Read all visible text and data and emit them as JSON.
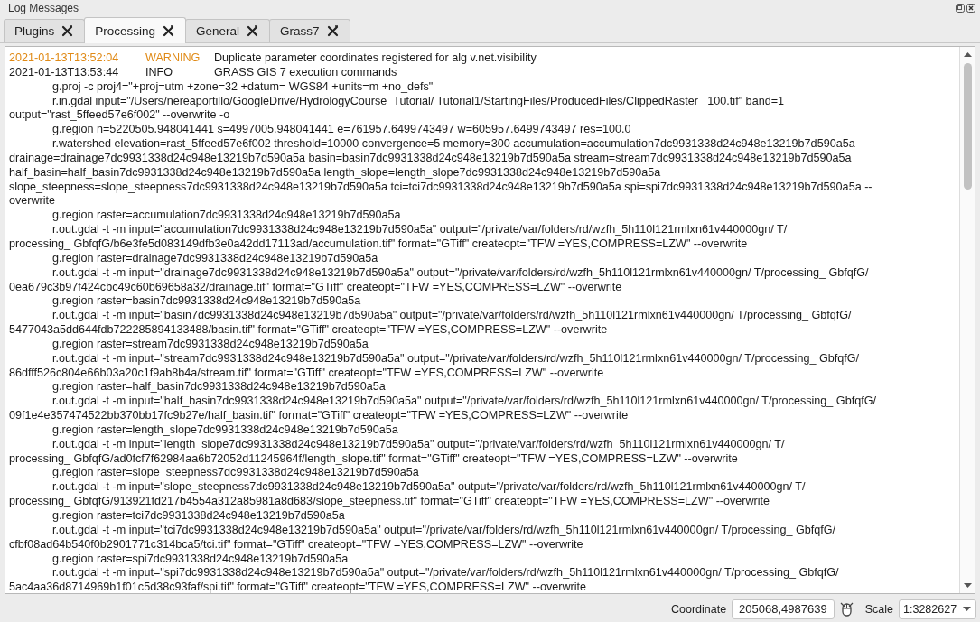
{
  "window": {
    "title": "Log Messages"
  },
  "tabs": [
    {
      "label": "Plugins",
      "selected": false
    },
    {
      "label": "Processing",
      "selected": true
    },
    {
      "label": "General",
      "selected": false
    },
    {
      "label": "Grass7",
      "selected": false
    }
  ],
  "log": {
    "entries": [
      {
        "kind": "warning",
        "time": "2021-01-13T13:52:04",
        "level": "WARNING",
        "message": "Duplicate parameter coordinates registered for alg v.net.visibility"
      },
      {
        "kind": "info",
        "time": "2021-01-13T13:53:44",
        "level": "INFO",
        "message": "GRASS GIS 7 execution commands"
      }
    ],
    "commands": [
      {
        "lines": [
          "g.proj -c proj4=\"+proj=utm +zone=32 +datum= WGS84 +units=m +no_defs\""
        ]
      },
      {
        "lines": [
          "r.in.gdal input=\"/Users/nereaportillo/GoogleDrive/HydrologyCourse_Tutorial/ Tutorial1/StartingFiles/ProducedFiles/ClippedRaster _100.tif\" band=1",
          "output=\"rast_5ffeed57e6f002\" --overwrite -o"
        ]
      },
      {
        "lines": [
          "g.region n=5220505.948041441 s=4997005.948041441 e=761957.6499743497 w=605957.6499743497 res=100.0"
        ]
      },
      {
        "lines": [
          "r.watershed elevation=rast_5ffeed57e6f002 threshold=10000 convergence=5 memory=300 accumulation=accumulation7dc9931338d24c948e13219b7d590a5a",
          "drainage=drainage7dc9931338d24c948e13219b7d590a5a basin=basin7dc9931338d24c948e13219b7d590a5a stream=stream7dc9931338d24c948e13219b7d590a5a",
          "half_basin=half_basin7dc9931338d24c948e13219b7d590a5a length_slope=length_slope7dc9931338d24c948e13219b7d590a5a",
          "slope_steepness=slope_steepness7dc9931338d24c948e13219b7d590a5a tci=tci7dc9931338d24c948e13219b7d590a5a spi=spi7dc9931338d24c948e13219b7d590a5a --",
          "overwrite"
        ]
      },
      {
        "lines": [
          "g.region raster=accumulation7dc9931338d24c948e13219b7d590a5a"
        ]
      },
      {
        "lines": [
          "r.out.gdal -t -m input=\"accumulation7dc9931338d24c948e13219b7d590a5a\" output=\"/private/var/folders/rd/wzfh_5h110l121rmlxn61v440000gn/ T/",
          "processing_ GbfqfG/b6e3fe5d083149dfb3e0a42dd17113ad/accumulation.tif\" format=\"GTiff\" createopt=\"TFW =YES,COMPRESS=LZW\" --overwrite"
        ]
      },
      {
        "lines": [
          "g.region raster=drainage7dc9931338d24c948e13219b7d590a5a"
        ]
      },
      {
        "lines": [
          "r.out.gdal -t -m input=\"drainage7dc9931338d24c948e13219b7d590a5a\" output=\"/private/var/folders/rd/wzfh_5h110l121rmlxn61v440000gn/ T/processing_ GbfqfG/",
          "0ea679c3b97f424cbc49c60b69658a32/drainage.tif\" format=\"GTiff\" createopt=\"TFW =YES,COMPRESS=LZW\" --overwrite"
        ]
      },
      {
        "lines": [
          "g.region raster=basin7dc9931338d24c948e13219b7d590a5a"
        ]
      },
      {
        "lines": [
          "r.out.gdal -t -m input=\"basin7dc9931338d24c948e13219b7d590a5a\" output=\"/private/var/folders/rd/wzfh_5h110l121rmlxn61v440000gn/ T/processing_ GbfqfG/",
          "5477043a5dd644fdb722285894133488/basin.tif\" format=\"GTiff\" createopt=\"TFW =YES,COMPRESS=LZW\" --overwrite"
        ]
      },
      {
        "lines": [
          "g.region raster=stream7dc9931338d24c948e13219b7d590a5a"
        ]
      },
      {
        "lines": [
          "r.out.gdal -t -m input=\"stream7dc9931338d24c948e13219b7d590a5a\" output=\"/private/var/folders/rd/wzfh_5h110l121rmlxn61v440000gn/ T/processing_ GbfqfG/",
          "86dfff526c804e66b03a20c1f9ab8b4a/stream.tif\" format=\"GTiff\" createopt=\"TFW =YES,COMPRESS=LZW\" --overwrite"
        ]
      },
      {
        "lines": [
          "g.region raster=half_basin7dc9931338d24c948e13219b7d590a5a"
        ]
      },
      {
        "lines": [
          "r.out.gdal -t -m input=\"half_basin7dc9931338d24c948e13219b7d590a5a\" output=\"/private/var/folders/rd/wzfh_5h110l121rmlxn61v440000gn/ T/processing_ GbfqfG/",
          "09f1e4e357474522bb370bb17fc9b27e/half_basin.tif\" format=\"GTiff\" createopt=\"TFW =YES,COMPRESS=LZW\" --overwrite"
        ]
      },
      {
        "lines": [
          "g.region raster=length_slope7dc9931338d24c948e13219b7d590a5a"
        ]
      },
      {
        "lines": [
          "r.out.gdal -t -m input=\"length_slope7dc9931338d24c948e13219b7d590a5a\" output=\"/private/var/folders/rd/wzfh_5h110l121rmlxn61v440000gn/ T/",
          "processing_ GbfqfG/ad0fcf7f62984aa6b72052d11245964f/length_slope.tif\" format=\"GTiff\" createopt=\"TFW =YES,COMPRESS=LZW\" --overwrite"
        ]
      },
      {
        "lines": [
          "g.region raster=slope_steepness7dc9931338d24c948e13219b7d590a5a"
        ]
      },
      {
        "lines": [
          "r.out.gdal -t -m input=\"slope_steepness7dc9931338d24c948e13219b7d590a5a\" output=\"/private/var/folders/rd/wzfh_5h110l121rmlxn61v440000gn/ T/",
          "processing_ GbfqfG/913921fd217b4554a312a85981a8d683/slope_steepness.tif\" format=\"GTiff\" createopt=\"TFW =YES,COMPRESS=LZW\" --overwrite"
        ]
      },
      {
        "lines": [
          "g.region raster=tci7dc9931338d24c948e13219b7d590a5a"
        ]
      },
      {
        "lines": [
          "r.out.gdal -t -m input=\"tci7dc9931338d24c948e13219b7d590a5a\" output=\"/private/var/folders/rd/wzfh_5h110l121rmlxn61v440000gn/ T/processing_ GbfqfG/",
          "cfbf08ad64b540f0b2901771c314bca5/tci.tif\" format=\"GTiff\" createopt=\"TFW =YES,COMPRESS=LZW\" --overwrite"
        ]
      },
      {
        "lines": [
          "g.region raster=spi7dc9931338d24c948e13219b7d590a5a"
        ]
      },
      {
        "lines": [
          "r.out.gdal -t -m input=\"spi7dc9931338d24c948e13219b7d590a5a\" output=\"/private/var/folders/rd/wzfh_5h110l121rmlxn61v440000gn/ T/processing_ GbfqfG/",
          "5ac4aa36d8714969b1f01c5d38c93faf/spi.tif\" format=\"GTiff\" createopt=\"TFW =YES,COMPRESS=LZW\" --overwrite"
        ]
      }
    ]
  },
  "status_bar": {
    "coordinate_label": "Coordinate",
    "coordinate": "205068,4987639",
    "scale_label": "Scale",
    "scale": "1:3282627"
  }
}
